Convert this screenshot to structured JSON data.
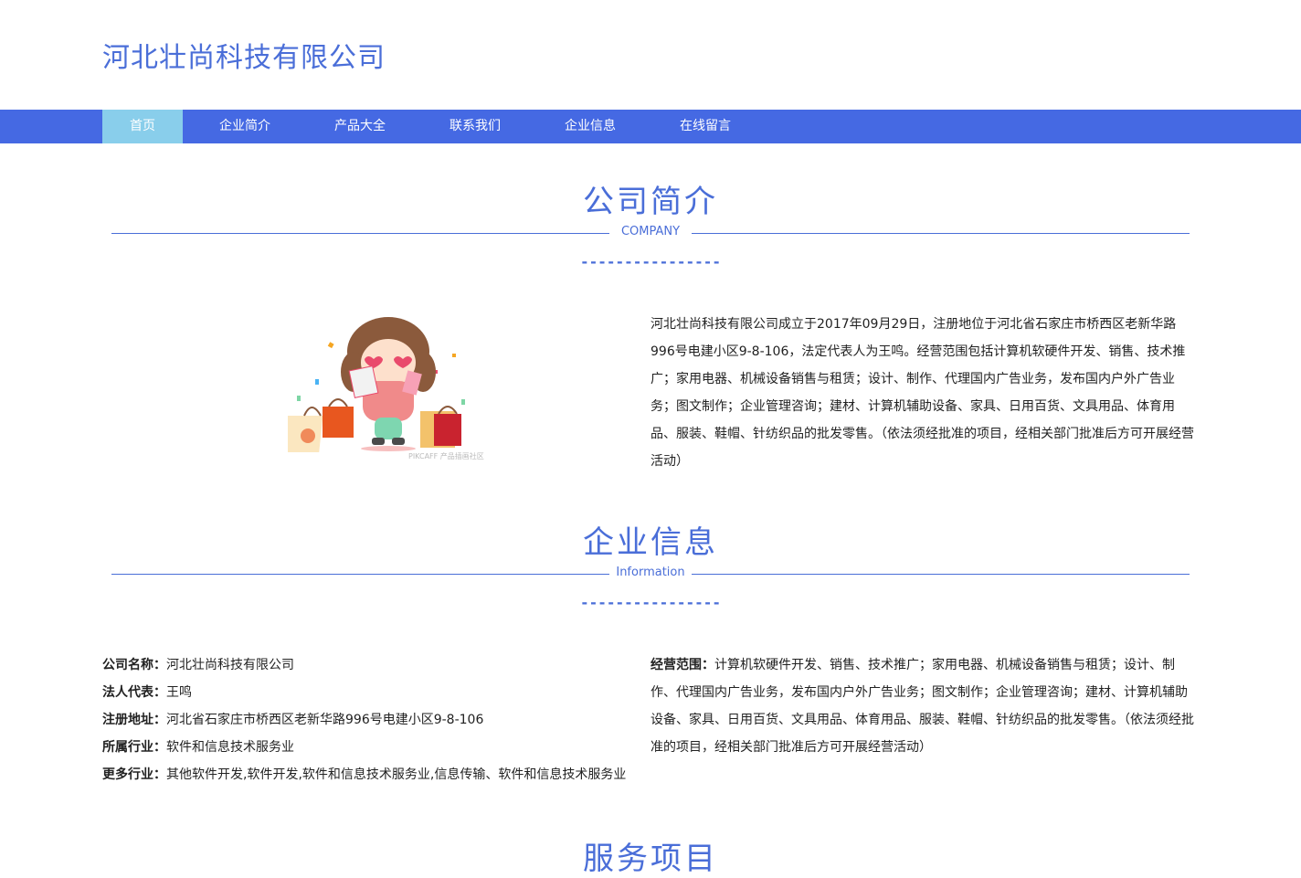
{
  "header": {
    "company_title": "河北壮尚科技有限公司"
  },
  "nav": {
    "items": [
      {
        "label": "首页",
        "active": true
      },
      {
        "label": "企业简介",
        "active": false
      },
      {
        "label": "产品大全",
        "active": false
      },
      {
        "label": "联系我们",
        "active": false
      },
      {
        "label": "企业信息",
        "active": false
      },
      {
        "label": "在线留言",
        "active": false
      }
    ]
  },
  "intro": {
    "title": "公司简介",
    "subtitle": "COMPANY",
    "dashes": "----------------",
    "text": "河北壮尚科技有限公司成立于2017年09月29日，注册地位于河北省石家庄市桥西区老新华路996号电建小区9-8-106，法定代表人为王鸣。经营范围包括计算机软硬件开发、销售、技术推广；家用电器、机械设备销售与租赁；设计、制作、代理国内广告业务，发布国内户外广告业务；图文制作；企业管理咨询；建材、计算机辅助设备、家具、日用百货、文具用品、体育用品、服装、鞋帽、针纺织品的批发零售。（依法须经批准的项目，经相关部门批准后方可开展经营活动）",
    "image_watermark": "PIKCAFF 产品插画社区"
  },
  "info": {
    "title": "企业信息",
    "subtitle": "Information",
    "dashes": "----------------",
    "rows": [
      {
        "label": "公司名称：",
        "value": "河北壮尚科技有限公司"
      },
      {
        "label": "法人代表：",
        "value": "王鸣"
      },
      {
        "label": "注册地址：",
        "value": "河北省石家庄市桥西区老新华路996号电建小区9-8-106"
      },
      {
        "label": "所属行业：",
        "value": "软件和信息技术服务业"
      },
      {
        "label": "更多行业：",
        "value": "其他软件开发,软件开发,软件和信息技术服务业,信息传输、软件和信息技术服务业"
      }
    ],
    "scope_label": "经营范围：",
    "scope_value": "计算机软硬件开发、销售、技术推广；家用电器、机械设备销售与租赁；设计、制作、代理国内广告业务，发布国内户外广告业务；图文制作；企业管理咨询；建材、计算机辅助设备、家具、日用百货、文具用品、体育用品、服装、鞋帽、针纺织品的批发零售。（依法须经批准的项目，经相关部门批准后方可开展经营活动）"
  },
  "services": {
    "title": "服务项目"
  },
  "colors": {
    "accent": "#4a6ed8",
    "nav_bg": "#4569e3",
    "nav_active": "#89ceeb"
  }
}
